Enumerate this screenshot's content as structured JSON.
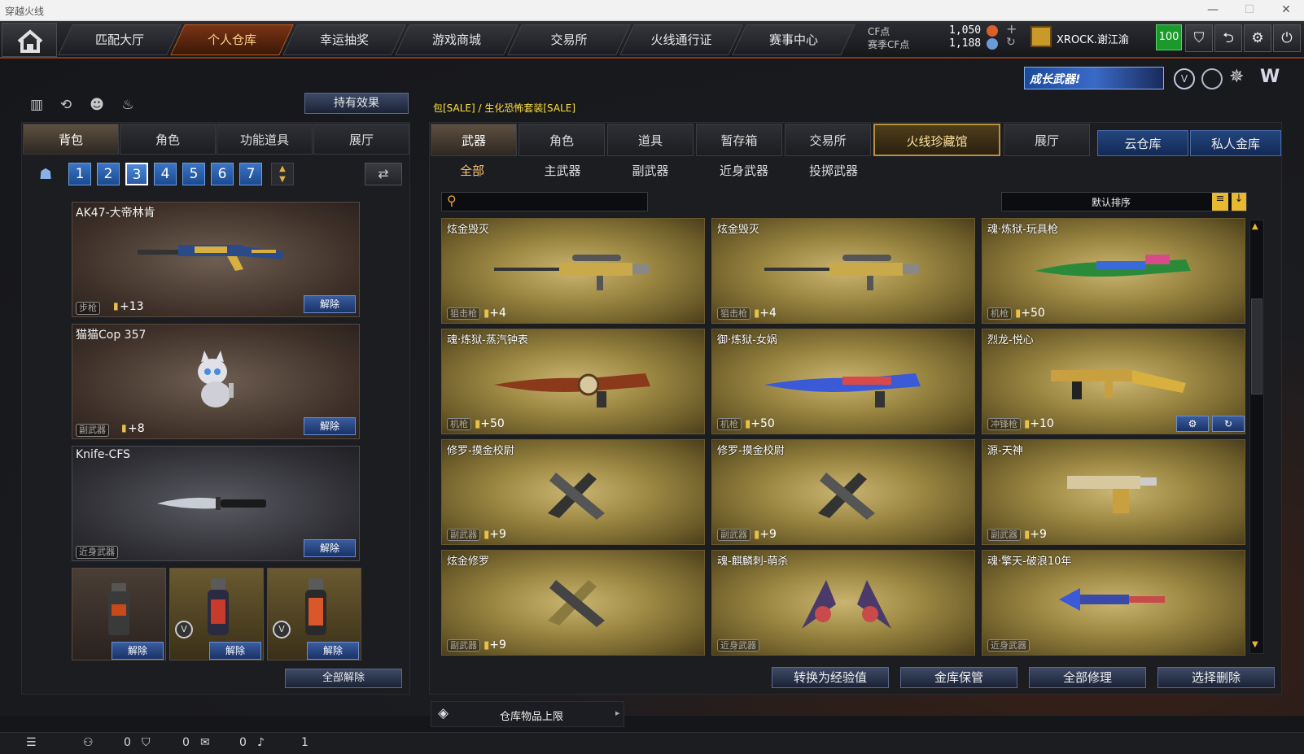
{
  "window": {
    "title": "穿越火线"
  },
  "nav": {
    "tabs": [
      "匹配大厅",
      "个人仓库",
      "幸运抽奖",
      "游戏商城",
      "交易所",
      "火线通行证",
      "赛事中心"
    ],
    "active_index": 1
  },
  "currency": {
    "cf_label": "CF点",
    "cf_value": "1,050",
    "season_label": "赛季CF点",
    "season_value": "1,188"
  },
  "user": {
    "name": "XROCK.谢江渝",
    "level": "100"
  },
  "growth_banner": "成长武器!",
  "left": {
    "effects_button": "持有效果",
    "tabs": [
      "背包",
      "角色",
      "功能道具",
      "展厅"
    ],
    "pages": [
      "1",
      "2",
      "3",
      "4",
      "5",
      "6",
      "7"
    ],
    "active_page": "3",
    "slots": [
      {
        "name": "AK47-大帝林肯",
        "type": "步枪",
        "level": "+13",
        "unequip": "解除"
      },
      {
        "name": "猫猫Cop 357",
        "type": "副武器",
        "level": "+8",
        "unequip": "解除"
      },
      {
        "name": "Knife-CFS",
        "type": "近身武器",
        "level": "",
        "unequip": "解除"
      }
    ],
    "grenades": [
      {
        "unequip": "解除"
      },
      {
        "unequip": "解除"
      },
      {
        "unequip": "解除"
      }
    ],
    "unequip_all": "全部解除"
  },
  "right": {
    "breadcrumb": "包[SALE] / 生化恐怖套装[SALE]",
    "tabs": [
      "武器",
      "角色",
      "道具",
      "暂存箱",
      "交易所",
      "火线珍藏馆",
      "展厅"
    ],
    "active_tab": "火线珍藏馆",
    "storage_tabs": [
      "云仓库",
      "私人金库"
    ],
    "sub_tabs": [
      "全部",
      "主武器",
      "副武器",
      "近身武器",
      "投掷武器"
    ],
    "sort_label": "默认排序",
    "items": [
      {
        "name": "炫金毁灭",
        "type": "狙击枪",
        "level": "+4"
      },
      {
        "name": "炫金毁灭",
        "type": "狙击枪",
        "level": "+4"
      },
      {
        "name": "魂·炼狱-玩具枪",
        "type": "机枪",
        "level": "+50"
      },
      {
        "name": "魂·炼狱-蒸汽钟表",
        "type": "机枪",
        "level": "+50"
      },
      {
        "name": "御·炼狱-女娲",
        "type": "机枪",
        "level": "+50"
      },
      {
        "name": "烈龙-悦心",
        "type": "冲锋枪",
        "level": "+10"
      },
      {
        "name": "修罗-摸金校尉",
        "type": "副武器",
        "level": "+9"
      },
      {
        "name": "修罗-摸金校尉",
        "type": "副武器",
        "level": "+9"
      },
      {
        "name": "源-天神",
        "type": "副武器",
        "level": "+9"
      },
      {
        "name": "炫金修罗",
        "type": "副武器",
        "level": "+9"
      },
      {
        "name": "魂-麒麟刺-萌杀",
        "type": "近身武器",
        "level": ""
      },
      {
        "name": "魂·擎天-破浪10年",
        "type": "近身武器",
        "level": ""
      }
    ],
    "actions": [
      "转换为经验值",
      "金库保管",
      "全部修理",
      "选择删除"
    ],
    "capacity_label": "仓库物品上限"
  },
  "status": {
    "v1": "0",
    "v2": "0",
    "v3": "0",
    "v4": "1"
  }
}
